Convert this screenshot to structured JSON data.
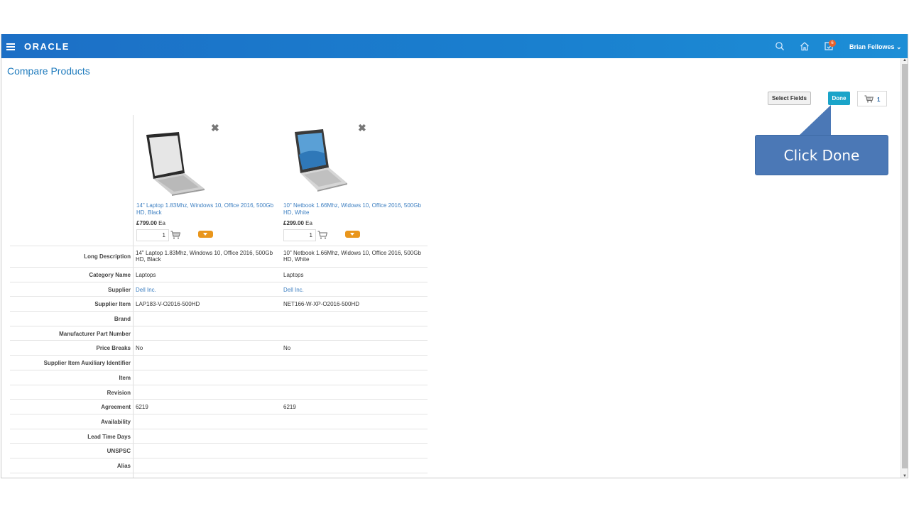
{
  "header": {
    "logo": "ORACLE",
    "user_name": "Brian Fellowes",
    "notification_count": "6"
  },
  "page": {
    "title": "Compare Products"
  },
  "toolbar": {
    "select_fields": "Select Fields",
    "done": "Done",
    "cart_count": "1"
  },
  "callout": {
    "text": "Click Done"
  },
  "products": [
    {
      "name": "14\" Laptop 1.83Mhz, Windows 10, Office 2016, 500Gb HD, Black",
      "price": "£799.00",
      "uom": "Ea",
      "qty": "1"
    },
    {
      "name": "10\" Netbook 1.66Mhz, Widows 10, Office 2016, 500Gb HD, White",
      "price": "£299.00",
      "uom": "Ea",
      "qty": "1"
    }
  ],
  "attributes": [
    {
      "label": "Long Description",
      "v1": "14\" Laptop 1.83Mhz, Windows 10, Office 2016, 500Gb HD, Black",
      "v2": "10\" Netbook 1.66Mhz, Widows 10, Office 2016, 500Gb HD, White"
    },
    {
      "label": "Category Name",
      "v1": "Laptops",
      "v2": "Laptops"
    },
    {
      "label": "Supplier",
      "v1": "Dell Inc.",
      "v2": "Dell Inc."
    },
    {
      "label": "Supplier Item",
      "v1": "LAP183-V-O2016-500HD",
      "v2": "NET166-W-XP-O2016-500HD"
    },
    {
      "label": "Brand",
      "v1": "",
      "v2": ""
    },
    {
      "label": "Manufacturer Part Number",
      "v1": "",
      "v2": ""
    },
    {
      "label": "Price Breaks",
      "v1": "No",
      "v2": "No"
    },
    {
      "label": "Supplier Item Auxiliary Identifier",
      "v1": "",
      "v2": ""
    },
    {
      "label": "Item",
      "v1": "",
      "v2": ""
    },
    {
      "label": "Revision",
      "v1": "",
      "v2": ""
    },
    {
      "label": "Agreement",
      "v1": "6219",
      "v2": "6219"
    },
    {
      "label": "Availability",
      "v1": "",
      "v2": ""
    },
    {
      "label": "Lead Time Days",
      "v1": "",
      "v2": ""
    },
    {
      "label": "UNSPSC",
      "v1": "",
      "v2": ""
    },
    {
      "label": "Alias",
      "v1": "",
      "v2": ""
    }
  ]
}
